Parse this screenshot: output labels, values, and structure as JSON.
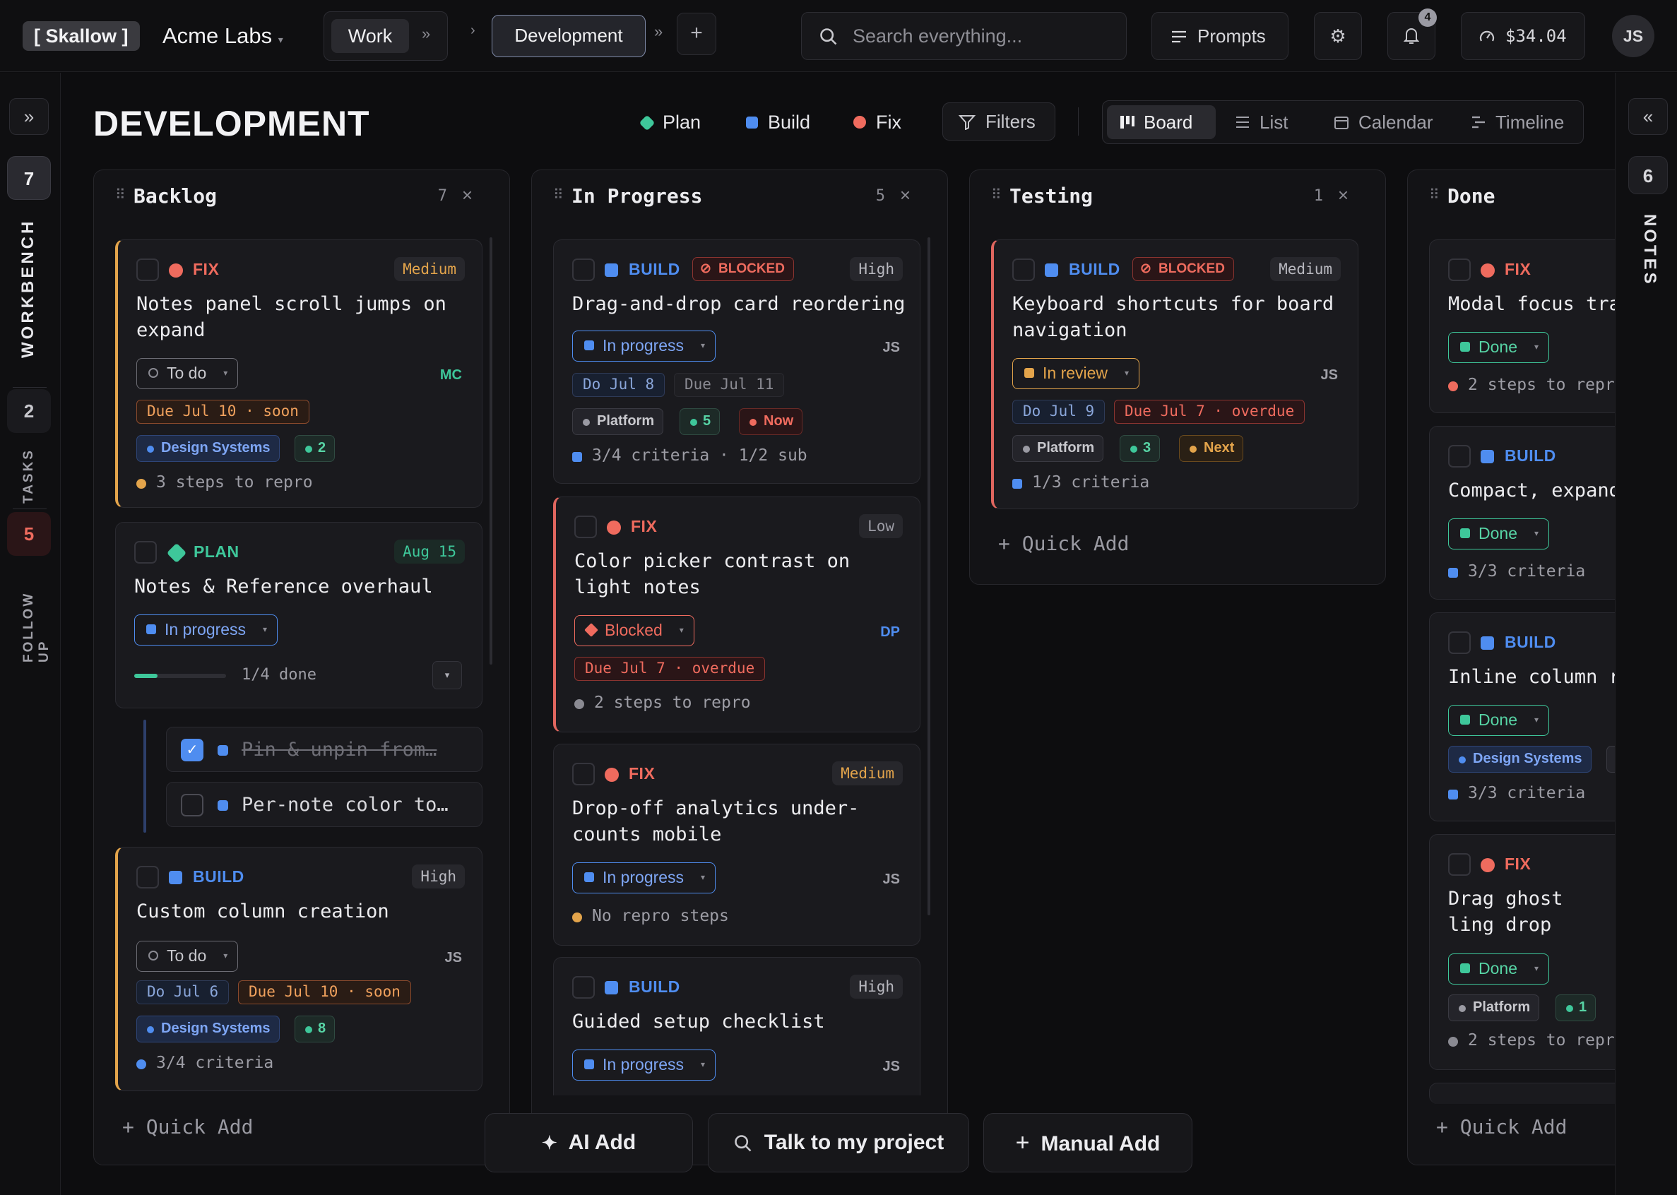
{
  "topbar": {
    "brand": "[ Skallow ]",
    "org": "Acme Labs",
    "work_tab": "Work",
    "dev_tab": "Development",
    "search_placeholder": "Search everything...",
    "prompts": "Prompts",
    "notif_count": "4",
    "balance": "$34.04",
    "user": "JS"
  },
  "left_rail": {
    "workbench_count": "7",
    "workbench": "WORKBENCH",
    "tasks_count": "2",
    "tasks": "TASKS",
    "followup_count": "5",
    "followup": "FOLLOW UP"
  },
  "right_rail": {
    "notes_count": "6",
    "notes": "NOTES"
  },
  "page": {
    "title": "DEVELOPMENT",
    "legend": [
      {
        "label": "Plan",
        "color": "#3ec79a"
      },
      {
        "label": "Build",
        "color": "#4f8df0"
      },
      {
        "label": "Fix",
        "color": "#ef6b5e"
      }
    ],
    "filters": "Filters",
    "views": [
      "Board",
      "List",
      "Calendar",
      "Timeline"
    ],
    "active_view": "Board"
  },
  "columns": [
    {
      "title": "Backlog",
      "count": "7",
      "quick_add": "+ Quick Add",
      "cards": [
        {
          "type": "FIX",
          "priority": "Medium",
          "title": "Notes panel scroll jumps on expand",
          "status": "To do",
          "assignee": "MC",
          "tags": [
            "Due Jul 10 · soon"
          ],
          "chips": [
            "Design Systems",
            "2"
          ],
          "footer": "3 steps to repro"
        },
        {
          "type": "PLAN",
          "date": "Aug 15",
          "title": "Notes & Reference overhaul",
          "status": "In progress",
          "progress_text": "1/4 done",
          "progress": 0.25,
          "subtasks": [
            "Pin & unpin from…",
            "Per-note color to…"
          ]
        },
        {
          "type": "BUILD",
          "priority": "High",
          "title": "Custom column creation",
          "status": "To do",
          "assignee": "JS",
          "tags": [
            "Do Jul 6",
            "Due Jul 10 · soon"
          ],
          "chips": [
            "Design Systems",
            "8"
          ],
          "footer": "3/4 criteria"
        }
      ]
    },
    {
      "title": "In Progress",
      "count": "5",
      "cards": [
        {
          "type": "BUILD",
          "blocked": "BLOCKED",
          "priority": "High",
          "title": "Drag-and-drop card reordering",
          "status": "In progress",
          "assignee": "JS",
          "tags": [
            "Do Jul 8",
            "Due Jul 11"
          ],
          "chips": [
            "Platform",
            "5",
            "Now"
          ],
          "footer": "3/4 criteria · 1/2 sub"
        },
        {
          "type": "FIX",
          "priority": "Low",
          "title": "Color picker contrast on light notes",
          "status": "Blocked",
          "assignee": "DP",
          "tags": [
            "Due Jul 7 · overdue"
          ],
          "footer": "2 steps to repro"
        },
        {
          "type": "FIX",
          "priority": "Medium",
          "title": "Drop-off analytics under-counts mobile",
          "status": "In progress",
          "assignee": "JS",
          "footer": "No repro steps"
        },
        {
          "type": "BUILD",
          "priority": "High",
          "title": "Guided setup checklist",
          "status": "In progress",
          "assignee": "JS"
        }
      ]
    },
    {
      "title": "Testing",
      "count": "1",
      "quick_add": "+ Quick Add",
      "cards": [
        {
          "type": "BUILD",
          "blocked": "BLOCKED",
          "priority": "Medium",
          "title": "Keyboard shortcuts for board navigation",
          "status": "In review",
          "assignee": "JS",
          "tags": [
            "Do Jul 9",
            "Due Jul 7 · overdue"
          ],
          "chips": [
            "Platform",
            "3",
            "Next"
          ],
          "footer": "1/3 criteria"
        }
      ]
    },
    {
      "title": "Done",
      "quick_add": "+ Quick Add",
      "cards": [
        {
          "type": "FIX",
          "title": "Modal focus tra",
          "status": "Done",
          "footer": "2 steps to repr"
        },
        {
          "type": "BUILD",
          "title": "Compact, expand",
          "status": "Done",
          "footer": "3/3 criteria"
        },
        {
          "type": "BUILD",
          "title": "Inline column r",
          "status": "Done",
          "chips": [
            "Design Systems"
          ],
          "footer": "3/3 criteria"
        },
        {
          "type": "FIX",
          "title": "Drag ghost ling drop",
          "status": "Done",
          "chips": [
            "Platform",
            "1"
          ],
          "footer": "2 steps to repr"
        }
      ]
    }
  ],
  "bottom": {
    "ai_add": "AI Add",
    "talk": "Talk to my project",
    "manual_add": "Manual Add"
  }
}
